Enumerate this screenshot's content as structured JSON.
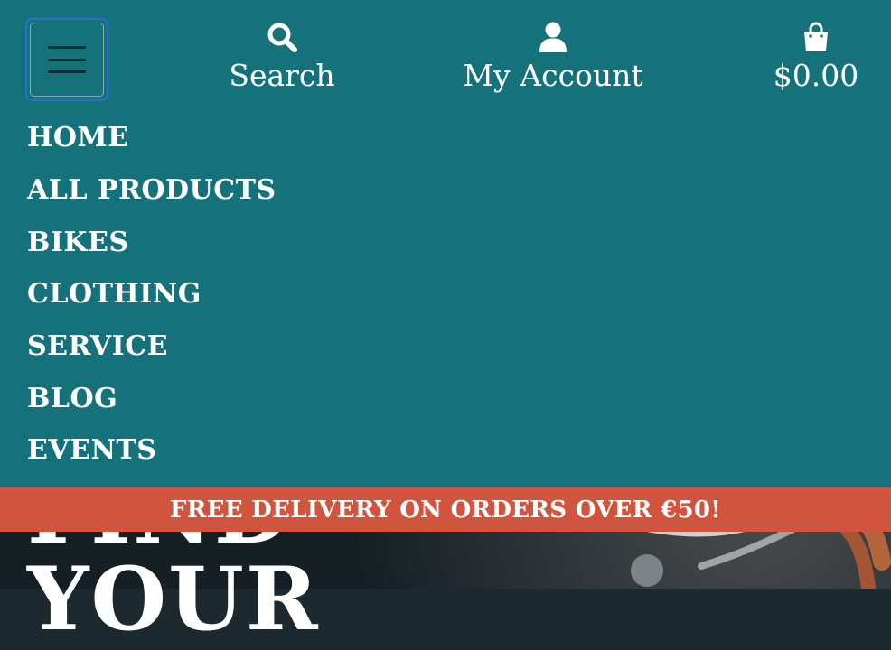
{
  "header": {
    "menu_icon": "hamburger-icon",
    "search": {
      "label": "Search",
      "icon": "search-icon"
    },
    "account": {
      "label": "My Account",
      "icon": "user-icon"
    },
    "cart": {
      "total": "$0.00",
      "icon": "shopping-bag-icon"
    }
  },
  "menu": {
    "items": [
      {
        "label": "HOME"
      },
      {
        "label": "ALL PRODUCTS"
      },
      {
        "label": "BIKES"
      },
      {
        "label": "CLOTHING"
      },
      {
        "label": "SERVICE"
      },
      {
        "label": "BLOG"
      },
      {
        "label": "EVENTS"
      }
    ]
  },
  "announcement": {
    "text": "FREE DELIVERY ON ORDERS OVER €50!"
  },
  "hero": {
    "line1": "FIND",
    "line2": "YOUR"
  },
  "colors": {
    "menu_bg": "#16727a",
    "announcement_bg": "#d1543f",
    "focus_ring": "#2d6bd6",
    "text": "#ffffff"
  }
}
